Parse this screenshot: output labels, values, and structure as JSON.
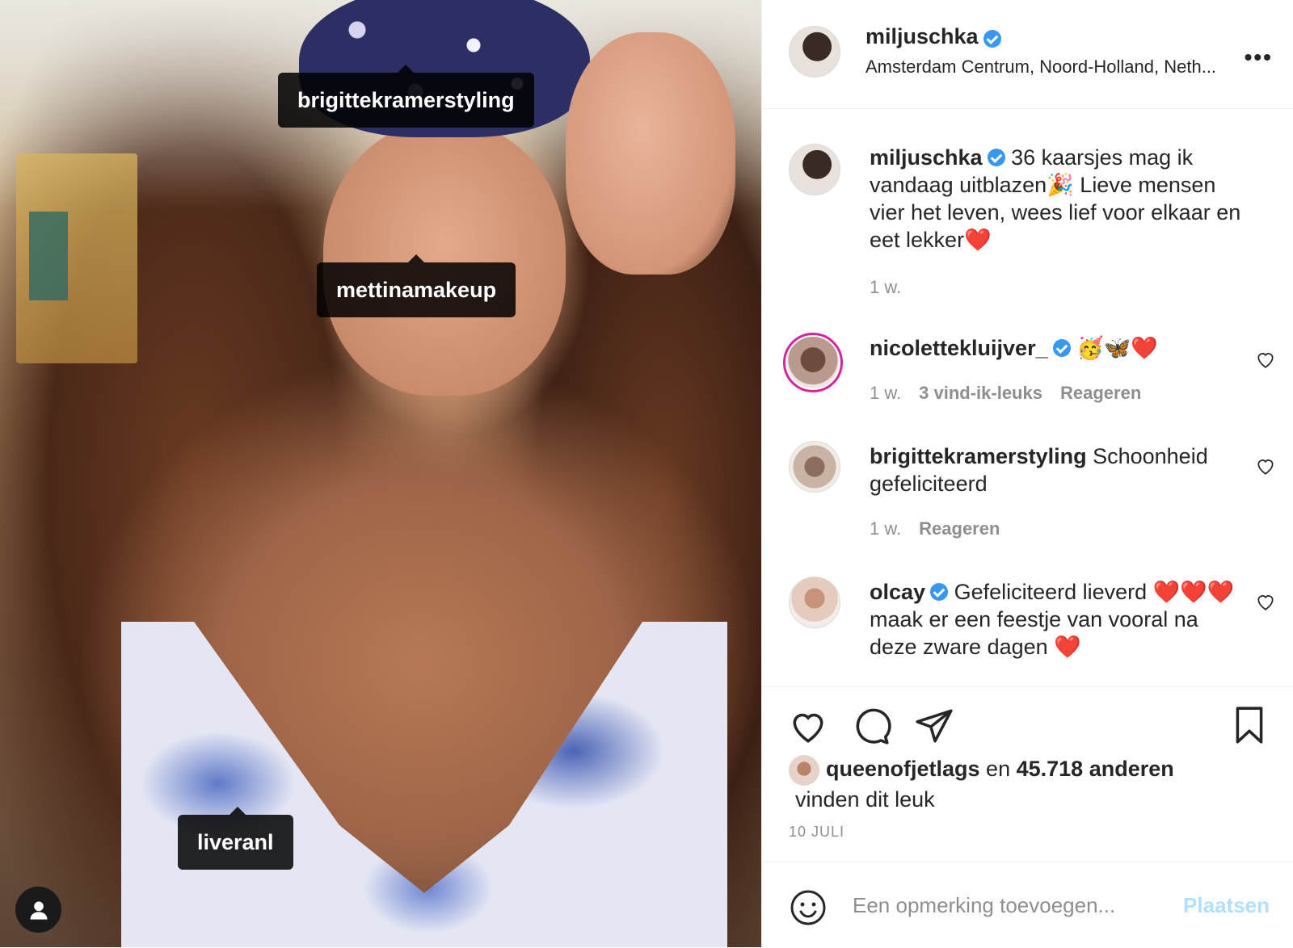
{
  "photo": {
    "tags": [
      "brigittekramerstyling",
      "mettinamakeup",
      "liveranl"
    ]
  },
  "header": {
    "username": "miljuschka",
    "location": "Amsterdam Centrum, Noord-Holland, Neth...",
    "more_label": "•••"
  },
  "caption": {
    "username": "miljuschka",
    "text": "36 kaarsjes mag ik vandaag uitblazen🎉 Lieve mensen vier het leven, wees lief voor elkaar en eet lekker❤️",
    "time": "1 w."
  },
  "comments": [
    {
      "username": "nicolettekluijver_",
      "text": "🥳🦋❤️",
      "time": "1 w.",
      "likes": "3 vind-ik-leuks",
      "reply": "Reageren"
    },
    {
      "username": "brigittekramerstyling",
      "text": "Schoonheid gefeliciteerd",
      "time": "1 w.",
      "reply": "Reageren"
    },
    {
      "username": "olcay",
      "text": "Gefeliciteerd lieverd ❤️❤️❤️ maak er een feestje van vooral na deze zware dagen ❤️"
    }
  ],
  "likes": {
    "user": "queenofjetlags",
    "middle": "en",
    "count": "45.718 anderen",
    "suffix": "vinden dit leuk"
  },
  "date": "10 JULI",
  "add_comment": {
    "placeholder": "Een opmerking toevoegen...",
    "post_label": "Plaatsen"
  },
  "colors": {
    "verified": "#3897f0",
    "post_disabled": "#b2dffc",
    "meta": "#8e8e8e"
  }
}
